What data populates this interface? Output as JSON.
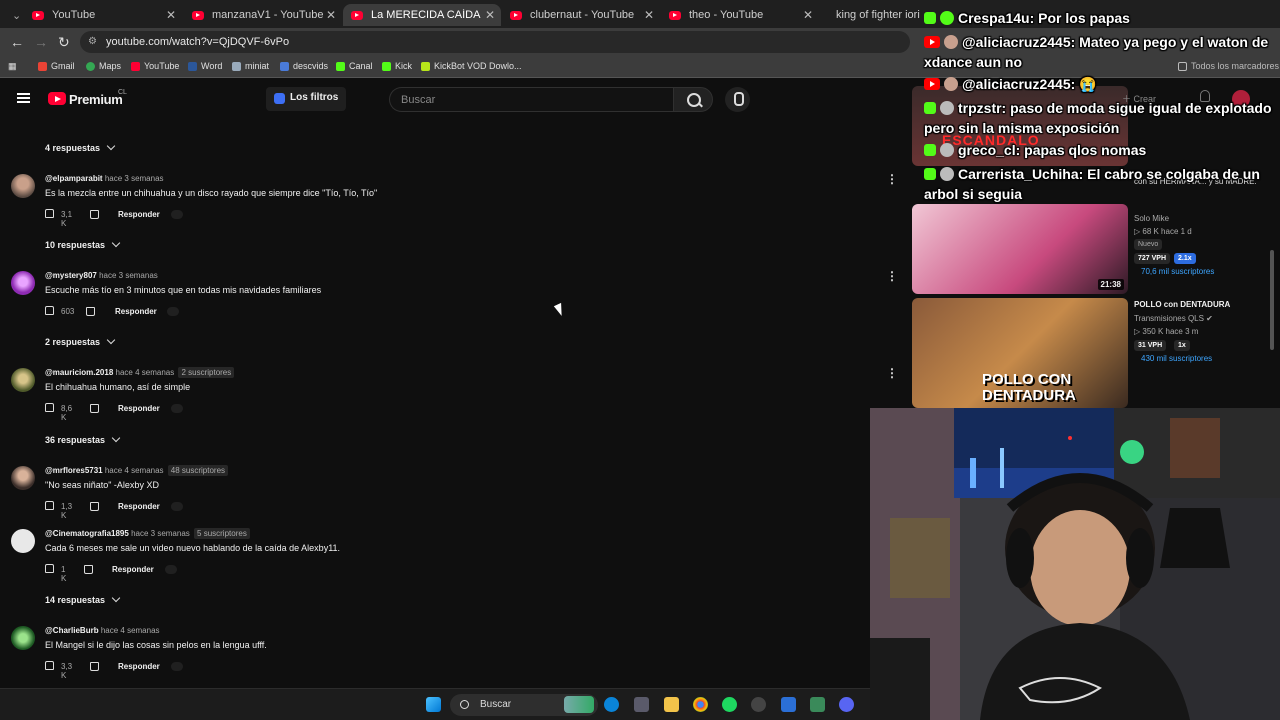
{
  "browser": {
    "tabs": [
      {
        "title": "YouTube",
        "icon": "youtube-icon"
      },
      {
        "title": "manzanaV1 - YouTube",
        "icon": "youtube-icon"
      },
      {
        "title": "La MERECIDA CAÍDA de ALEXB",
        "icon": "youtube-icon",
        "active": true
      },
      {
        "title": "clubernaut - YouTube",
        "icon": "youtube-icon"
      },
      {
        "title": "theo - YouTube",
        "icon": "youtube-icon"
      },
      {
        "title": "king of fighter iori - Bus",
        "icon": "google-icon"
      }
    ],
    "url": "youtube.com/watch?v=QjDQVF-6vPo",
    "bookmarks": [
      "Gmail",
      "Maps",
      "YouTube",
      "Word",
      "miniat",
      "descvids",
      "Canal",
      "Kick",
      "KickBot VOD Dowlo..."
    ],
    "all_bookmarks": "Todos los marcadores"
  },
  "youtube": {
    "logo_text": "Premium",
    "logo_region": "CL",
    "filters_label": "Los filtros",
    "search_placeholder": "Buscar",
    "create_label": "Crear"
  },
  "comments": [
    {
      "handle": "@elpamparabit",
      "time": "hace 3 semanas",
      "subs": "",
      "text": "Es la mezcla entre un chihuahua y un disco rayado que siempre dice \"Tío, Tío, Tío\"",
      "likes": "3,1 K",
      "reply": "Responder",
      "replies": "10 respuestas"
    },
    {
      "handle": "@mystery807",
      "time": "hace 3 semanas",
      "subs": "",
      "text": "Escuche más tío en 3 minutos que en todas mis navidades familiares",
      "likes": "603",
      "reply": "Responder",
      "replies": "2 respuestas"
    },
    {
      "handle": "@mauriciom.2018",
      "time": "hace 4 semanas",
      "subs": "2 suscriptores",
      "text": "El chihuahua humano, así de simple",
      "likes": "8,6 K",
      "reply": "Responder",
      "replies": "36 respuestas"
    },
    {
      "handle": "@mrflores5731",
      "time": "hace 4 semanas",
      "subs": "48 suscriptores",
      "text": "\"No seas niñato\" -Alexby XD",
      "likes": "1,3 K",
      "reply": "Responder",
      "replies": ""
    },
    {
      "handle": "@Cinematografia1895",
      "time": "hace 3 semanas",
      "subs": "5 suscriptores",
      "text": "Cada 6 meses me sale un video nuevo hablando de la caída de Alexby11.",
      "likes": "1 K",
      "reply": "Responder",
      "replies": "14 respuestas"
    },
    {
      "handle": "@CharlieBurb",
      "time": "hace 4 semanas",
      "subs": "",
      "text": "El Mangel si le dijo las cosas sin pelos en la lengua ufff.",
      "likes": "3,3 K",
      "reply": "Responder",
      "replies": ""
    }
  ],
  "top_replies": "4 respuestas",
  "related": [
    {
      "title": "",
      "channel": "Solo Mike",
      "stats": "▷ 68 K  hace 1 d",
      "new": "Nuevo",
      "vph": "727 VPH",
      "mult": "2.1x",
      "subs": "70,6 mil suscriptores",
      "duration": "21:38",
      "partial_title": "con su HERMANA... y su MADRE."
    },
    {
      "title": "POLLO con DENTADURA",
      "channel": "Transmisiones QLS ✔",
      "stats": "▷ 350 K  hace 3 m",
      "vph": "31 VPH",
      "mult": "1x",
      "subs": "430 mil suscriptores",
      "duration": "",
      "thumb_text": "POLLO CON DENTADURA"
    }
  ],
  "chat": [
    {
      "platform": "kick",
      "text": "Crespa14u: Por los papas"
    },
    {
      "platform": "youtube",
      "text": "@aliciacruz2445: Mateo ya pego y el waton de xdance aun no"
    },
    {
      "platform": "youtube",
      "text": "@aliciacruz2445: 😭"
    },
    {
      "platform": "kick",
      "text": "trpzstr: paso de moda sigue igual de explotado pero sin la misma exposición"
    },
    {
      "platform": "kick",
      "text": "greco_cl: papas qlos nomas"
    },
    {
      "platform": "kick",
      "text": "Carrerista_Uchiha: El cabro se colgaba de un arbol si seguia"
    }
  ],
  "taskbar": {
    "search_label": "Buscar"
  },
  "colors": {
    "youtube_red": "#ff0033",
    "kick_green": "#53fc18",
    "bg": "#0f0f0f"
  }
}
